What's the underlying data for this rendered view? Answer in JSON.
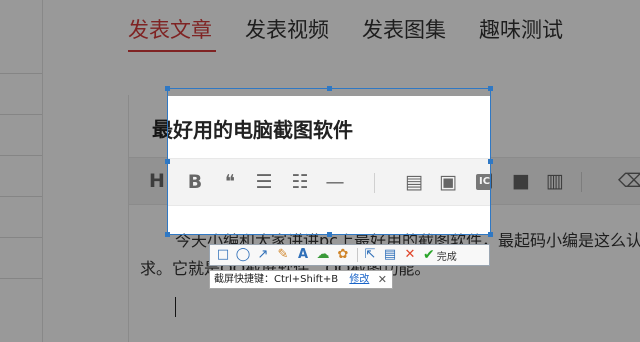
{
  "tabs": [
    {
      "label": "发表文章",
      "active": true
    },
    {
      "label": "发表视频",
      "active": false
    },
    {
      "label": "发表图集",
      "active": false
    },
    {
      "label": "趣味测试",
      "active": false
    }
  ],
  "editor": {
    "title": "最好用的电脑截图软件",
    "toolbar": {
      "heading": "H",
      "bold": "B",
      "quote": "❝",
      "bullet_list": "☰",
      "number_list": "☷",
      "divider": "—",
      "doc": "▤",
      "image": "▣",
      "ic": "IC",
      "video": "■",
      "chart": "▥",
      "eraser": "⌫"
    },
    "body": {
      "line1": "今天小编和大家讲讲pc上最好用的截图软件，最起码小编是这么认为的，",
      "line2": "求。它就是QQ截屏软件，QQ截图功能。"
    }
  },
  "capture_toolbar": {
    "tools": [
      {
        "name": "rectangle-tool-icon",
        "glyph": "□",
        "color": "#2f6fb8"
      },
      {
        "name": "ellipse-tool-icon",
        "glyph": "◯",
        "color": "#2f6fb8"
      },
      {
        "name": "arrow-tool-icon",
        "glyph": "↗",
        "color": "#2f6fb8"
      },
      {
        "name": "brush-tool-icon",
        "glyph": "✎",
        "color": "#d0852a"
      },
      {
        "name": "text-tool-icon",
        "glyph": "A",
        "color": "#2f6fb8"
      },
      {
        "name": "mosaic-tool-icon",
        "glyph": "☁",
        "color": "#3a9a3a"
      },
      {
        "name": "palette-tool-icon",
        "glyph": "✿",
        "color": "#d0852a"
      },
      {
        "name": "share-icon",
        "glyph": "⇱",
        "color": "#2f6fb8"
      },
      {
        "name": "save-icon",
        "glyph": "▤",
        "color": "#2f6fb8"
      },
      {
        "name": "cancel-icon",
        "glyph": "✕",
        "color": "#e0452a"
      }
    ],
    "done_label": "完成",
    "done_color": "#2aa52a"
  },
  "hint": {
    "text": "截屏快捷键：Ctrl+Shift+B",
    "link": "修改",
    "close": "✕"
  },
  "colors": {
    "accent": "#d43b3b",
    "selection": "#2f78c4"
  }
}
